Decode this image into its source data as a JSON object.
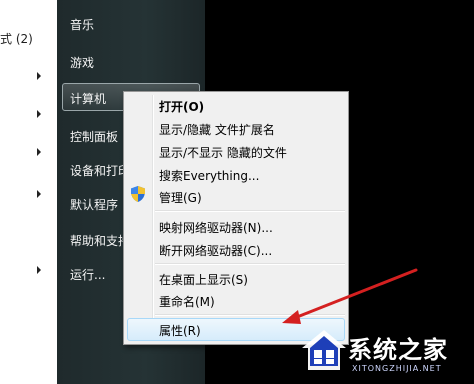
{
  "left_pane": {
    "partial_text": "式 (2)"
  },
  "start_menu": {
    "items": [
      {
        "label": "音乐"
      },
      {
        "label": "游戏"
      },
      {
        "label": "计算机"
      },
      {
        "label": "控制面板"
      },
      {
        "label": "设备和打印"
      },
      {
        "label": "默认程序"
      },
      {
        "label": "帮助和支持"
      },
      {
        "label": "运行..."
      }
    ]
  },
  "context_menu": {
    "items": [
      {
        "label": "打开(O)",
        "bold": true
      },
      {
        "label": "显示/隐藏 文件扩展名"
      },
      {
        "label": "显示/不显示 隐藏的文件"
      },
      {
        "label": "搜索Everything..."
      },
      {
        "label": "管理(G)",
        "icon": "uac-shield-icon"
      },
      {
        "label": "映射网络驱动器(N)..."
      },
      {
        "label": "断开网络驱动器(C)..."
      },
      {
        "label": "在桌面上显示(S)"
      },
      {
        "label": "重命名(M)"
      },
      {
        "label": "属性(R)",
        "highlighted": true
      }
    ]
  },
  "annotation": {
    "type": "arrow",
    "color": "#d42020"
  },
  "watermark": {
    "title": "系统之家",
    "subtitle": "XITONGZHIJIA.NET"
  }
}
